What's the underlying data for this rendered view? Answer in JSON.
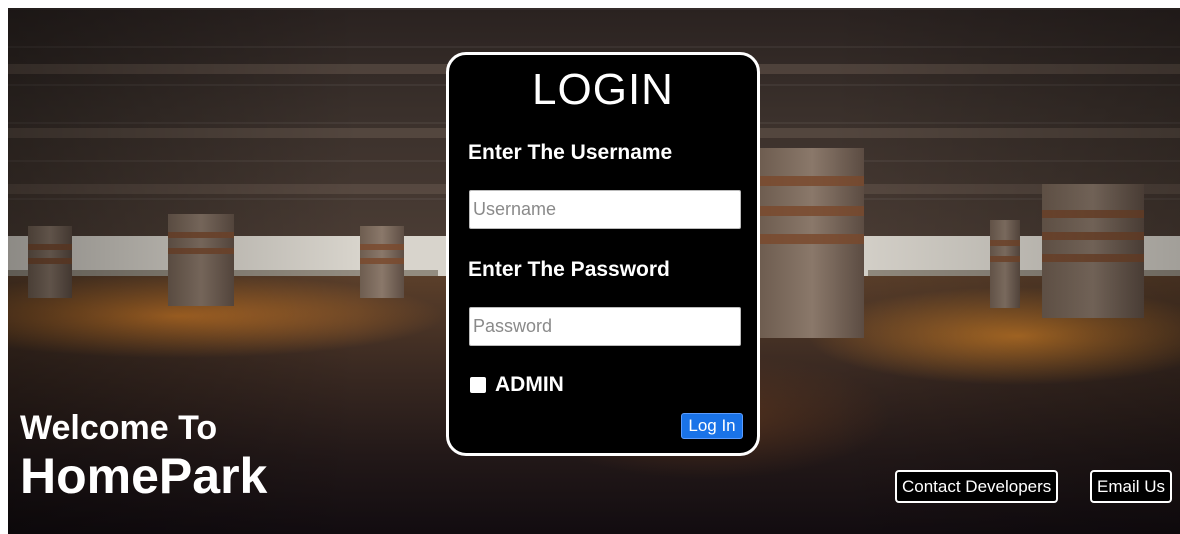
{
  "login": {
    "title": "LOGIN",
    "username_label": "Enter The Username",
    "username_placeholder": "Username",
    "username_value": "",
    "password_label": "Enter The Password",
    "password_placeholder": "Password",
    "password_value": "",
    "admin_label": "ADMIN",
    "admin_checked": false,
    "submit_label": "Log In"
  },
  "welcome": {
    "line1": "Welcome To",
    "line2": "HomePark"
  },
  "footer": {
    "contact_label": "Contact Developers",
    "email_label": "Email Us"
  },
  "colors": {
    "panel_bg": "#000000",
    "panel_border": "#ffffff",
    "button_accent": "#1a73e8"
  }
}
